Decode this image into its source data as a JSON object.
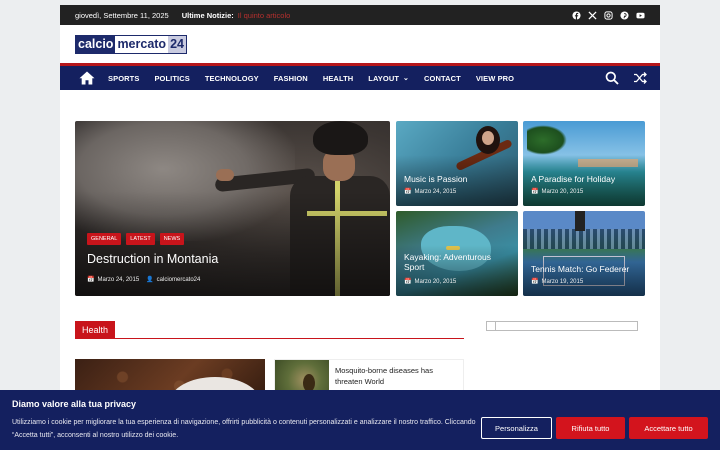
{
  "topbar": {
    "date": "giovedì, Settembre 11, 2025",
    "news_label": "Ultime Notizie:",
    "news_link": "Il quinto articolo",
    "socials": [
      "facebook-icon",
      "x-icon",
      "instagram-icon",
      "pinterest-icon",
      "youtube-icon"
    ]
  },
  "logo": {
    "part1": "calcio",
    "part2": "mercato",
    "part3": "24"
  },
  "nav": {
    "items": [
      "SPORTS",
      "POLITICS",
      "TECHNOLOGY",
      "FASHION",
      "HEALTH",
      "LAYOUT",
      "CONTACT",
      "VIEW PRO"
    ]
  },
  "featured": {
    "main": {
      "tags": [
        "GENERAL",
        "LATEST",
        "NEWS"
      ],
      "title": "Destruction in Montania",
      "date": "Marzo 24, 2015",
      "author": "calciomercato24"
    },
    "cards": [
      {
        "title": "Music is Passion",
        "date": "Marzo 24, 2015"
      },
      {
        "title": "A Paradise for Holiday",
        "date": "Marzo 20, 2015"
      },
      {
        "title": "Kayaking: Adventurous Sport",
        "date": "Marzo 20, 2015"
      },
      {
        "title": "Tennis Match: Go Federer",
        "date": "Marzo 19, 2015"
      }
    ]
  },
  "section": {
    "title": "Health",
    "article_title": "Mosquito-borne diseases has threaten World"
  },
  "cookie": {
    "title": "Diamo valore alla tua privacy",
    "text": "Utilizziamo i cookie per migliorare la tua esperienza di navigazione, offrirti pubblicità o contenuti personalizzati e analizzare il nostro traffico. Cliccando “Accetta tutti”, acconsenti al nostro utilizzo dei cookie.",
    "customize": "Personalizza",
    "reject": "Rifiuta tutto",
    "accept": "Accettare tutto"
  },
  "colors": {
    "nav_bg": "#14205f",
    "accent_red": "#c8141b",
    "topbar_bg": "#222222"
  }
}
